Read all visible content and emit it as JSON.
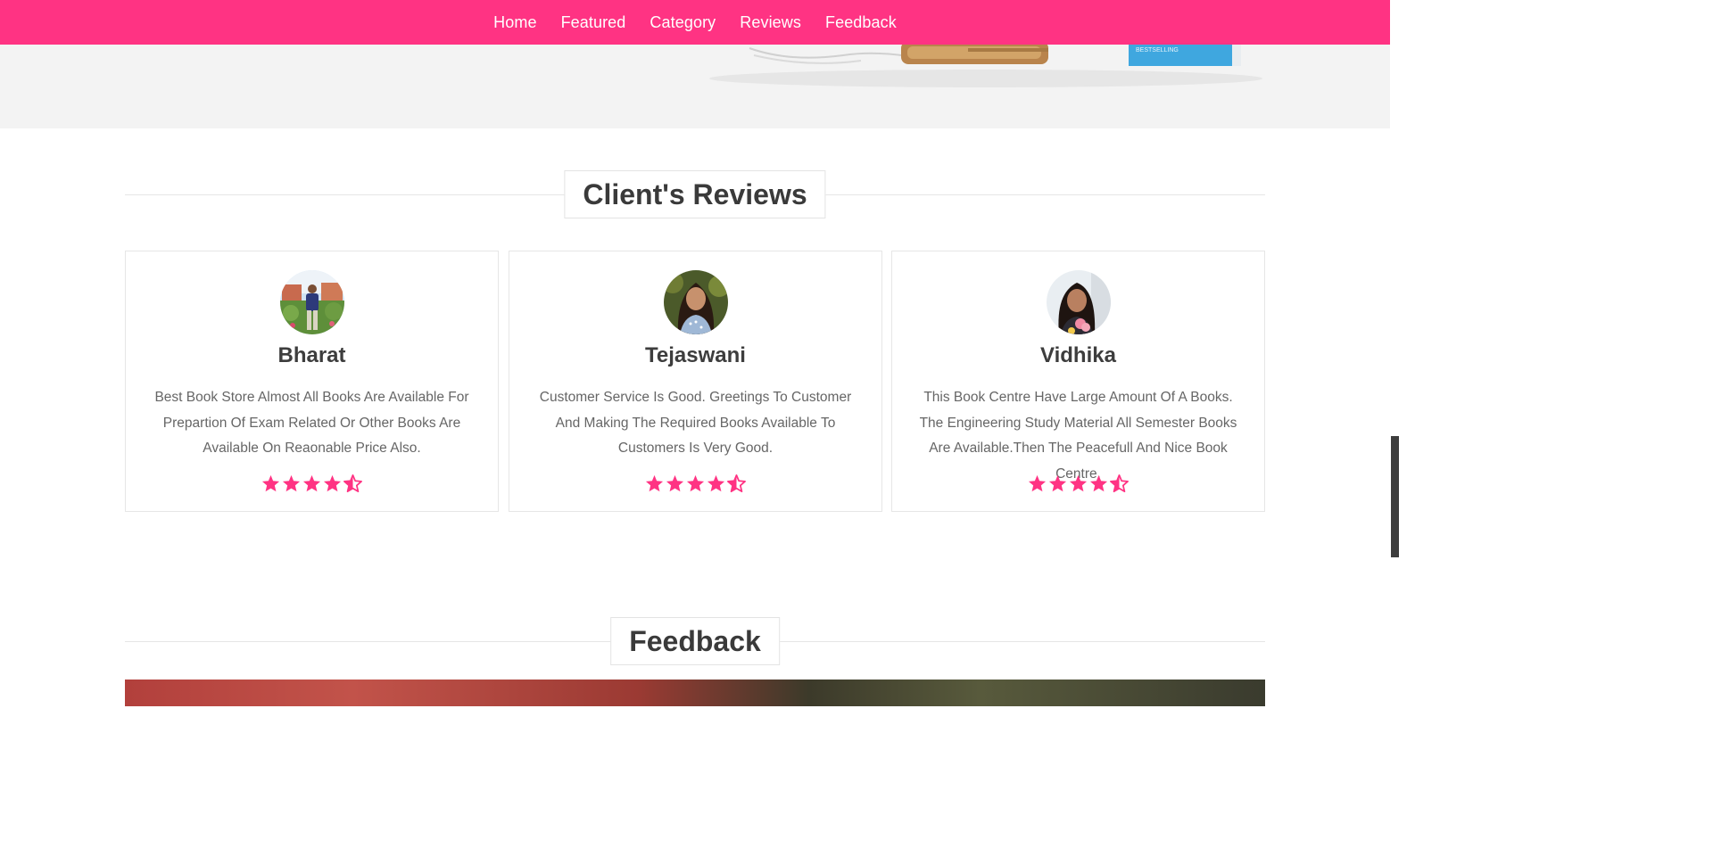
{
  "nav": {
    "items": [
      "Home",
      "Featured",
      "Category",
      "Reviews",
      "Feedback"
    ]
  },
  "colors": {
    "accent": "#ff3383",
    "banner_bg": "#f3f3f3",
    "star": "#ff3383"
  },
  "reviews_section": {
    "title": "Client's Reviews",
    "cards": [
      {
        "name": "Bharat",
        "text": "Best Book Store Almost All Books Are Available For Prepartion Of Exam Related Or Other Books Are Available On Reaonable Price Also.",
        "rating": 4.5
      },
      {
        "name": "Tejaswani",
        "text": "Customer Service Is Good. Greetings To Customer And Making The Required Books Available To Customers Is Very Good.",
        "rating": 4.5
      },
      {
        "name": "Vidhika",
        "text": "This Book Centre Have Large Amount Of A Books. The Engineering Study Material All Semester Books Are Available.Then The Peacefull And Nice Book Centre.",
        "rating": 4.5
      }
    ]
  },
  "feedback_section": {
    "title": "Feedback"
  }
}
